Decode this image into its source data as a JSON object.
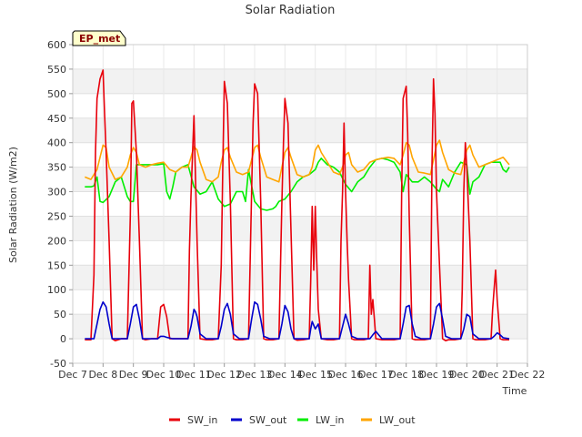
{
  "chart_data": {
    "type": "line",
    "title": "Solar Radiation",
    "xlabel": "Time",
    "ylabel": "Solar Radiation (W/m2)",
    "badge": "EP_met",
    "xlim": [
      7,
      22
    ],
    "ylim": [
      -50,
      600
    ],
    "x_ticks": [
      7,
      8,
      9,
      10,
      11,
      12,
      13,
      14,
      15,
      16,
      17,
      18,
      19,
      20,
      21,
      22
    ],
    "x_tick_labels": [
      "Dec 7",
      "Dec 8",
      "Dec 9",
      "Dec 10",
      "Dec 11",
      "Dec 12",
      "Dec 13",
      "Dec 14",
      "Dec 15",
      "Dec 16",
      "Dec 17",
      "Dec 18",
      "Dec 19",
      "Dec 20",
      "Dec 21",
      "Dec 22"
    ],
    "y_ticks": [
      -50,
      0,
      50,
      100,
      150,
      200,
      250,
      300,
      350,
      400,
      450,
      500,
      550,
      600
    ],
    "grid": true,
    "legend_position": "bottom",
    "series": [
      {
        "name": "SW_in",
        "color": "#e8000b",
        "x": [
          7.4,
          7.6,
          7.7,
          7.75,
          7.8,
          7.9,
          8.0,
          8.05,
          8.1,
          8.2,
          8.3,
          8.4,
          8.6,
          8.8,
          8.9,
          8.95,
          9.0,
          9.1,
          9.2,
          9.3,
          9.4,
          9.6,
          9.8,
          9.9,
          10.0,
          10.1,
          10.2,
          10.4,
          10.6,
          10.8,
          10.85,
          10.9,
          11.0,
          11.1,
          11.2,
          11.4,
          11.6,
          11.8,
          11.9,
          11.95,
          12.0,
          12.1,
          12.2,
          12.3,
          12.4,
          12.6,
          12.8,
          12.9,
          12.95,
          13.0,
          13.1,
          13.2,
          13.3,
          13.4,
          13.6,
          13.8,
          13.9,
          13.95,
          14.0,
          14.1,
          14.2,
          14.3,
          14.4,
          14.6,
          14.8,
          14.85,
          14.9,
          14.95,
          15.0,
          15.05,
          15.1,
          15.2,
          15.4,
          15.6,
          15.8,
          15.85,
          15.9,
          15.95,
          16.0,
          16.05,
          16.1,
          16.2,
          16.3,
          16.4,
          16.6,
          16.75,
          16.8,
          16.85,
          16.9,
          16.95,
          17.0,
          17.2,
          17.4,
          17.6,
          17.8,
          17.85,
          17.9,
          18.0,
          18.05,
          18.1,
          18.2,
          18.3,
          18.4,
          18.6,
          18.8,
          18.85,
          18.9,
          18.95,
          19.0,
          19.1,
          19.2,
          19.3,
          19.4,
          19.6,
          19.8,
          19.85,
          19.9,
          19.95,
          20.0,
          20.1,
          20.2,
          20.3,
          20.4,
          20.6,
          20.8,
          20.85,
          20.9,
          20.95,
          21.0,
          21.1,
          21.2,
          21.4
        ],
        "y": [
          -2,
          -2,
          130,
          380,
          490,
          530,
          548,
          460,
          380,
          200,
          0,
          -4,
          0,
          0,
          250,
          480,
          485,
          380,
          200,
          0,
          -2,
          0,
          0,
          65,
          70,
          45,
          0,
          0,
          0,
          0,
          180,
          290,
          455,
          200,
          0,
          -2,
          -2,
          0,
          150,
          350,
          525,
          480,
          280,
          0,
          -2,
          -2,
          0,
          300,
          440,
          520,
          500,
          280,
          0,
          -2,
          -2,
          0,
          280,
          400,
          490,
          440,
          220,
          0,
          -3,
          -2,
          0,
          120,
          270,
          140,
          270,
          160,
          60,
          0,
          -2,
          -2,
          0,
          200,
          300,
          440,
          300,
          200,
          120,
          0,
          -2,
          -2,
          -2,
          0,
          150,
          50,
          80,
          40,
          0,
          -2,
          -2,
          -2,
          0,
          300,
          490,
          515,
          420,
          250,
          0,
          -2,
          -2,
          -2,
          0,
          350,
          530,
          460,
          300,
          150,
          0,
          -4,
          -2,
          -2,
          0,
          100,
          300,
          400,
          350,
          200,
          0,
          -2,
          -2,
          -2,
          0,
          60,
          100,
          140,
          80,
          0,
          -2,
          -2
        ]
      },
      {
        "name": "SW_out",
        "color": "#0000cc",
        "x": [
          7.4,
          7.7,
          7.8,
          7.9,
          8.0,
          8.1,
          8.2,
          8.3,
          8.5,
          8.8,
          8.9,
          9.0,
          9.1,
          9.2,
          9.3,
          9.5,
          9.8,
          9.9,
          10.0,
          10.1,
          10.3,
          10.8,
          10.9,
          11.0,
          11.05,
          11.1,
          11.2,
          11.4,
          11.8,
          11.9,
          12.0,
          12.1,
          12.2,
          12.3,
          12.5,
          12.8,
          12.9,
          13.0,
          13.1,
          13.2,
          13.3,
          13.5,
          13.8,
          13.9,
          14.0,
          14.1,
          14.2,
          14.3,
          14.5,
          14.8,
          14.85,
          14.9,
          15.0,
          15.1,
          15.2,
          15.4,
          15.8,
          15.9,
          16.0,
          16.1,
          16.2,
          16.4,
          16.8,
          16.9,
          17.0,
          17.2,
          17.8,
          17.9,
          18.0,
          18.1,
          18.2,
          18.3,
          18.5,
          18.8,
          18.9,
          19.0,
          19.1,
          19.2,
          19.3,
          19.5,
          19.8,
          19.9,
          20.0,
          20.1,
          20.2,
          20.4,
          20.8,
          20.9,
          21.0,
          21.1,
          21.2,
          21.4
        ],
        "y": [
          0,
          0,
          30,
          60,
          75,
          65,
          30,
          0,
          0,
          0,
          30,
          65,
          70,
          40,
          0,
          0,
          0,
          5,
          5,
          3,
          0,
          0,
          25,
          60,
          55,
          45,
          10,
          0,
          0,
          25,
          60,
          72,
          50,
          10,
          0,
          0,
          40,
          75,
          70,
          40,
          5,
          0,
          0,
          30,
          68,
          55,
          20,
          0,
          0,
          0,
          20,
          35,
          20,
          30,
          0,
          0,
          0,
          25,
          50,
          30,
          5,
          0,
          0,
          8,
          15,
          0,
          0,
          30,
          65,
          68,
          30,
          5,
          0,
          0,
          30,
          65,
          72,
          40,
          5,
          0,
          0,
          20,
          50,
          45,
          10,
          0,
          0,
          5,
          12,
          8,
          2,
          0
        ]
      },
      {
        "name": "LW_in",
        "color": "#00ee00",
        "x": [
          7.4,
          7.6,
          7.7,
          7.8,
          7.9,
          8.0,
          8.2,
          8.4,
          8.6,
          8.8,
          8.9,
          9.0,
          9.1,
          9.2,
          9.4,
          9.6,
          9.8,
          10.0,
          10.1,
          10.2,
          10.3,
          10.4,
          10.6,
          10.8,
          11.0,
          11.2,
          11.4,
          11.6,
          11.8,
          12.0,
          12.2,
          12.4,
          12.6,
          12.7,
          12.8,
          13.0,
          13.2,
          13.4,
          13.6,
          13.7,
          13.8,
          14.0,
          14.2,
          14.4,
          14.6,
          14.8,
          15.0,
          15.1,
          15.2,
          15.4,
          15.6,
          15.8,
          16.0,
          16.2,
          16.4,
          16.6,
          16.8,
          17.0,
          17.2,
          17.4,
          17.6,
          17.8,
          17.9,
          18.0,
          18.2,
          18.4,
          18.6,
          18.8,
          19.0,
          19.1,
          19.2,
          19.4,
          19.6,
          19.8,
          20.0,
          20.1,
          20.2,
          20.4,
          20.6,
          20.8,
          21.0,
          21.1,
          21.2,
          21.3,
          21.4
        ],
        "y": [
          310,
          310,
          312,
          330,
          280,
          278,
          290,
          320,
          330,
          290,
          280,
          280,
          355,
          355,
          355,
          355,
          355,
          357,
          300,
          285,
          310,
          340,
          350,
          355,
          310,
          295,
          300,
          320,
          285,
          270,
          275,
          300,
          300,
          280,
          345,
          280,
          265,
          262,
          265,
          270,
          280,
          285,
          300,
          320,
          330,
          335,
          345,
          360,
          368,
          355,
          350,
          340,
          315,
          300,
          320,
          330,
          350,
          365,
          368,
          365,
          360,
          340,
          300,
          335,
          320,
          320,
          330,
          320,
          305,
          300,
          325,
          310,
          340,
          360,
          355,
          295,
          320,
          330,
          355,
          360,
          360,
          360,
          345,
          340,
          350
        ]
      },
      {
        "name": "LW_out",
        "color": "#ffa500",
        "x": [
          7.4,
          7.6,
          7.8,
          7.9,
          8.0,
          8.1,
          8.2,
          8.4,
          8.6,
          8.8,
          8.9,
          9.0,
          9.1,
          9.2,
          9.4,
          9.6,
          9.8,
          10.0,
          10.2,
          10.4,
          10.6,
          10.8,
          10.9,
          11.0,
          11.1,
          11.2,
          11.4,
          11.6,
          11.8,
          11.9,
          12.0,
          12.1,
          12.2,
          12.4,
          12.6,
          12.8,
          12.9,
          13.0,
          13.1,
          13.2,
          13.4,
          13.6,
          13.8,
          13.9,
          14.0,
          14.1,
          14.2,
          14.4,
          14.6,
          14.8,
          14.9,
          15.0,
          15.1,
          15.2,
          15.4,
          15.6,
          15.8,
          15.9,
          16.0,
          16.1,
          16.2,
          16.4,
          16.6,
          16.8,
          17.0,
          17.2,
          17.4,
          17.6,
          17.8,
          17.9,
          18.0,
          18.1,
          18.2,
          18.4,
          18.6,
          18.8,
          18.9,
          19.0,
          19.1,
          19.2,
          19.4,
          19.6,
          19.8,
          19.9,
          20.0,
          20.1,
          20.2,
          20.4,
          20.6,
          20.8,
          21.0,
          21.2,
          21.4
        ],
        "y": [
          330,
          325,
          345,
          370,
          395,
          390,
          350,
          325,
          330,
          350,
          375,
          390,
          380,
          355,
          350,
          355,
          358,
          360,
          345,
          340,
          350,
          350,
          370,
          392,
          385,
          360,
          325,
          320,
          330,
          360,
          385,
          390,
          370,
          340,
          335,
          340,
          365,
          390,
          395,
          370,
          330,
          325,
          320,
          350,
          380,
          390,
          370,
          335,
          330,
          335,
          350,
          385,
          395,
          380,
          360,
          340,
          335,
          350,
          375,
          380,
          355,
          340,
          345,
          360,
          365,
          368,
          370,
          368,
          355,
          375,
          400,
          395,
          370,
          340,
          338,
          335,
          365,
          395,
          405,
          380,
          345,
          338,
          335,
          360,
          385,
          395,
          375,
          350,
          355,
          360,
          365,
          370,
          355
        ]
      }
    ]
  }
}
